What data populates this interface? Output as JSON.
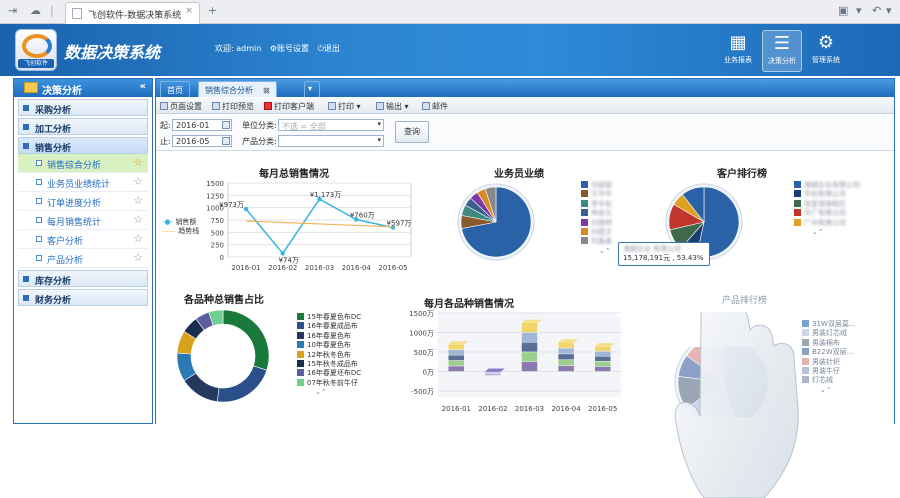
{
  "browser": {
    "tab_title": "飞创软件-数据决策系统"
  },
  "header": {
    "logo_text": "飞创软件",
    "app_title": "数据决策系统",
    "welcome": "欢迎: admin",
    "account_settings": "账号设置",
    "logout": "退出",
    "nav": [
      {
        "label": "业务报表",
        "icon": "table-icon"
      },
      {
        "label": "决策分析",
        "icon": "list-icon"
      },
      {
        "label": "管理系统",
        "icon": "gear-icon"
      }
    ]
  },
  "sidebar": {
    "title": "决策分析",
    "groups": [
      {
        "label": "采购分析"
      },
      {
        "label": "加工分析"
      },
      {
        "label": "销售分析",
        "items": [
          "销售综合分析",
          "业务员业绩统计",
          "订单进度分析",
          "每月销售统计",
          "客户分析",
          "产品分析"
        ]
      },
      {
        "label": "库存分析"
      },
      {
        "label": "财务分析"
      }
    ]
  },
  "tabs": [
    {
      "label": "首页"
    },
    {
      "label": "销售综合分析"
    }
  ],
  "toolbar": {
    "page_setup": "页面设置",
    "print_preview": "打印预览",
    "print_client": "打印客户端",
    "print": "打印",
    "export": "输出",
    "mail": "邮件"
  },
  "filters": {
    "start_label": "起:",
    "start_value": "2016-01",
    "end_label": "止:",
    "end_value": "2016-05",
    "unit_label": "单位分类:",
    "unit_placeholder": "不选 = 全部",
    "product_label": "产品分类:",
    "product_value": "",
    "query_button": "查询"
  },
  "tooltip": {
    "line1": "海越企业 有限公司",
    "line2": "15,178,191元 , 53.43%"
  },
  "chart_data": [
    {
      "type": "line",
      "title": "每月总销售情况",
      "categories": [
        "2016-01",
        "2016-02",
        "2016-03",
        "2016-04",
        "2016-05"
      ],
      "series": [
        {
          "name": "销售额",
          "values": [
            973,
            74,
            1173,
            760,
            597
          ],
          "color": "#36b6e3"
        },
        {
          "name": "趋势线",
          "values": [
            730,
            700,
            670,
            640,
            612
          ],
          "color": "#f2b35a"
        }
      ],
      "data_labels": [
        "¥973万",
        "¥74万",
        "¥1,173万",
        "¥760万",
        "¥597万"
      ],
      "yticks": [
        "0",
        "250",
        "500",
        "750",
        "1000",
        "1250",
        "1500"
      ],
      "ylim": [
        0,
        1500
      ]
    },
    {
      "type": "pie",
      "title": "业务员业绩",
      "legend": [
        "刘斌斌",
        "王华华",
        "李丰权",
        "林泉光",
        "刘建明",
        "刘建文",
        "刘晶晶"
      ],
      "colors": [
        "#2a62a8",
        "#8a5a2d",
        "#3f8a80",
        "#3a5f90",
        "#7b3aa6",
        "#d98a22",
        "#888888"
      ],
      "values": [
        72,
        6,
        5,
        4,
        4,
        4,
        5
      ]
    },
    {
      "type": "pie",
      "title": "客户排行榜",
      "legend": [
        "海越企业有限公司",
        "华创有限公司",
        "张家港保税区",
        "华广有限公司",
        "广州有限公司"
      ],
      "colors": [
        "#2a62a8",
        "#1a3c6e",
        "#3f6a4a",
        "#c0362c",
        "#e0a020"
      ],
      "values": [
        53.43,
        8,
        10,
        12,
        6,
        10.57
      ]
    },
    {
      "type": "pie",
      "title": "各品种总销售占比",
      "legend": [
        "15年春夏色布DC",
        "16年春夏成品布",
        "16年春夏色布",
        "10年春夏色布",
        "12年秋冬色布",
        "15年秋冬成品布",
        "16年春夏坯布DC",
        "07年秋冬前牛仔"
      ],
      "colors": [
        "#1a7a3c",
        "#2b4f8a",
        "#23395e",
        "#2c7ab5",
        "#d9a21b",
        "#1b2d4d",
        "#5a5e9e",
        "#6fcf8e"
      ],
      "values": [
        30,
        22,
        14,
        10,
        8,
        6,
        5,
        5
      ]
    },
    {
      "type": "bar",
      "title": "每月各品种销售情况",
      "categories": [
        "2016-01",
        "2016-02",
        "2016-03",
        "2016-04",
        "2016-05"
      ],
      "values": [
        700,
        -100,
        1250,
        750,
        650
      ],
      "yticks": [
        "-500万",
        "0万",
        "500万",
        "1000万",
        "1500万"
      ],
      "ylim": [
        -500,
        1500
      ]
    },
    {
      "type": "pie",
      "title": "产品排行榜",
      "legend": [
        "31W双层莫...",
        "男装灯芯绒",
        "男装棉布",
        "B22W双层...",
        "男装针织",
        "男装牛仔",
        "灯芯绒"
      ],
      "colors": [
        "#7d9ed0",
        "#c9d6ea",
        "#9aa6b6",
        "#8ea0c6",
        "#e8b3b3",
        "#b4c2d8",
        "#aab4c4"
      ],
      "values": [
        45,
        20,
        12,
        8,
        6,
        5,
        4
      ]
    }
  ]
}
